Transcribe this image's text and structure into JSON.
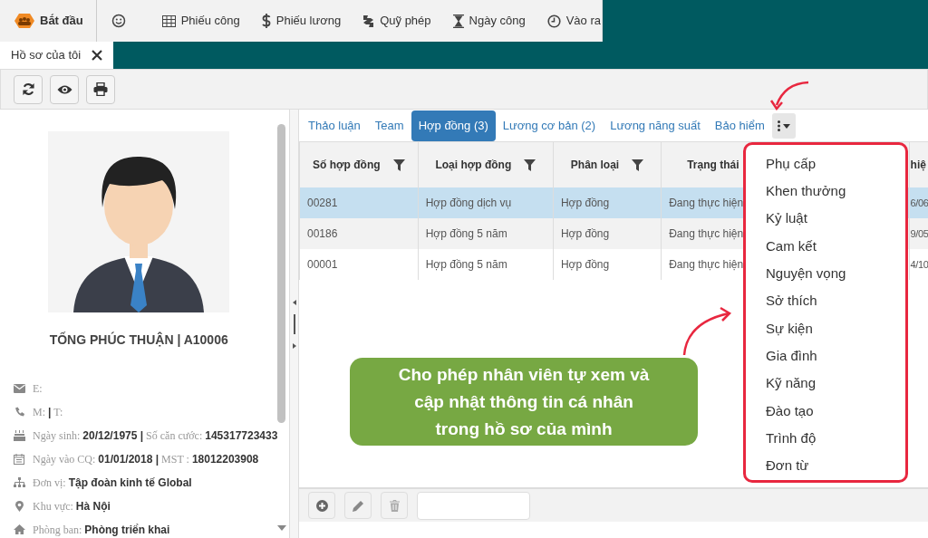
{
  "top_menu": [
    {
      "label": "Bắt đầu",
      "kind": "start"
    },
    {
      "kind": "emoji"
    },
    {
      "label": "Phiếu công",
      "kind": "item"
    },
    {
      "label": "Phiếu lương",
      "kind": "item"
    },
    {
      "label": "Quỹ phép",
      "kind": "item"
    },
    {
      "label": "Ngày công",
      "kind": "item"
    },
    {
      "label": "Vào ra",
      "kind": "item"
    }
  ],
  "open_tabs": [
    {
      "label": "Hồ sơ của tôi",
      "selected": true
    }
  ],
  "profile": {
    "name": "TỐNG PHÚC THUẬN | A10006",
    "fields": [
      "E:",
      "M: **|** T:",
      "Ngày sinh: **20/12/1975 |** Số căn cước: **145317723433**",
      "Ngày vào CQ: **01/01/2018 |** MST : **18012203908**",
      "Đơn vị: **Tập đoàn kinh tế Global**",
      "Khu vực: **Hà Nội**",
      "Phòng ban: **Phòng triển khai**"
    ]
  },
  "detail_tabs": [
    {
      "label": "Thảo luận",
      "selected": false
    },
    {
      "label": "Team",
      "selected": false
    },
    {
      "label": "Hợp đồng (3)",
      "selected": true
    },
    {
      "label": "Lương cơ bản (2)",
      "selected": false
    },
    {
      "label": "Lương năng suất",
      "selected": false
    },
    {
      "label": "Bảo hiểm",
      "selected": false
    }
  ],
  "more_menu": {
    "expanded": true,
    "items": [
      "Phụ cấp",
      "Khen thưởng",
      "Kỷ luật",
      "Cam kết",
      "Nguyện vọng",
      "Sở thích",
      "Sự kiện",
      "Gia đình",
      "Kỹ năng",
      "Đào tạo",
      "Trình độ",
      "Đơn từ"
    ]
  },
  "table": {
    "columns": [
      {
        "label": "Số hợp đồng",
        "filter": true
      },
      {
        "label": "Loại hợp đồng",
        "filter": true
      },
      {
        "label": "Phân loại",
        "filter": true
      },
      {
        "label": "Trạng thái"
      },
      {
        "label": "hiệ"
      }
    ],
    "rows": [
      {
        "cells": [
          "00281",
          "Hợp đồng dịch vụ",
          "Hợp đồng",
          "Đang thực hiện",
          "6/06"
        ],
        "selected": true
      },
      {
        "cells": [
          "00186",
          "Hợp đồng 5 năm",
          "Hợp đồng",
          "Đang thực hiện",
          "9/05"
        ],
        "selected": false
      },
      {
        "cells": [
          "00001",
          "Hợp đồng 5 năm",
          "Hợp đồng",
          "Đang thực hiện",
          "4/10"
        ],
        "selected": false
      }
    ]
  },
  "callout": {
    "lines": [
      "Cho phép nhân viên tự xem và",
      "cập nhật thông tin cá nhân",
      "trong hồ sơ của mình"
    ]
  }
}
